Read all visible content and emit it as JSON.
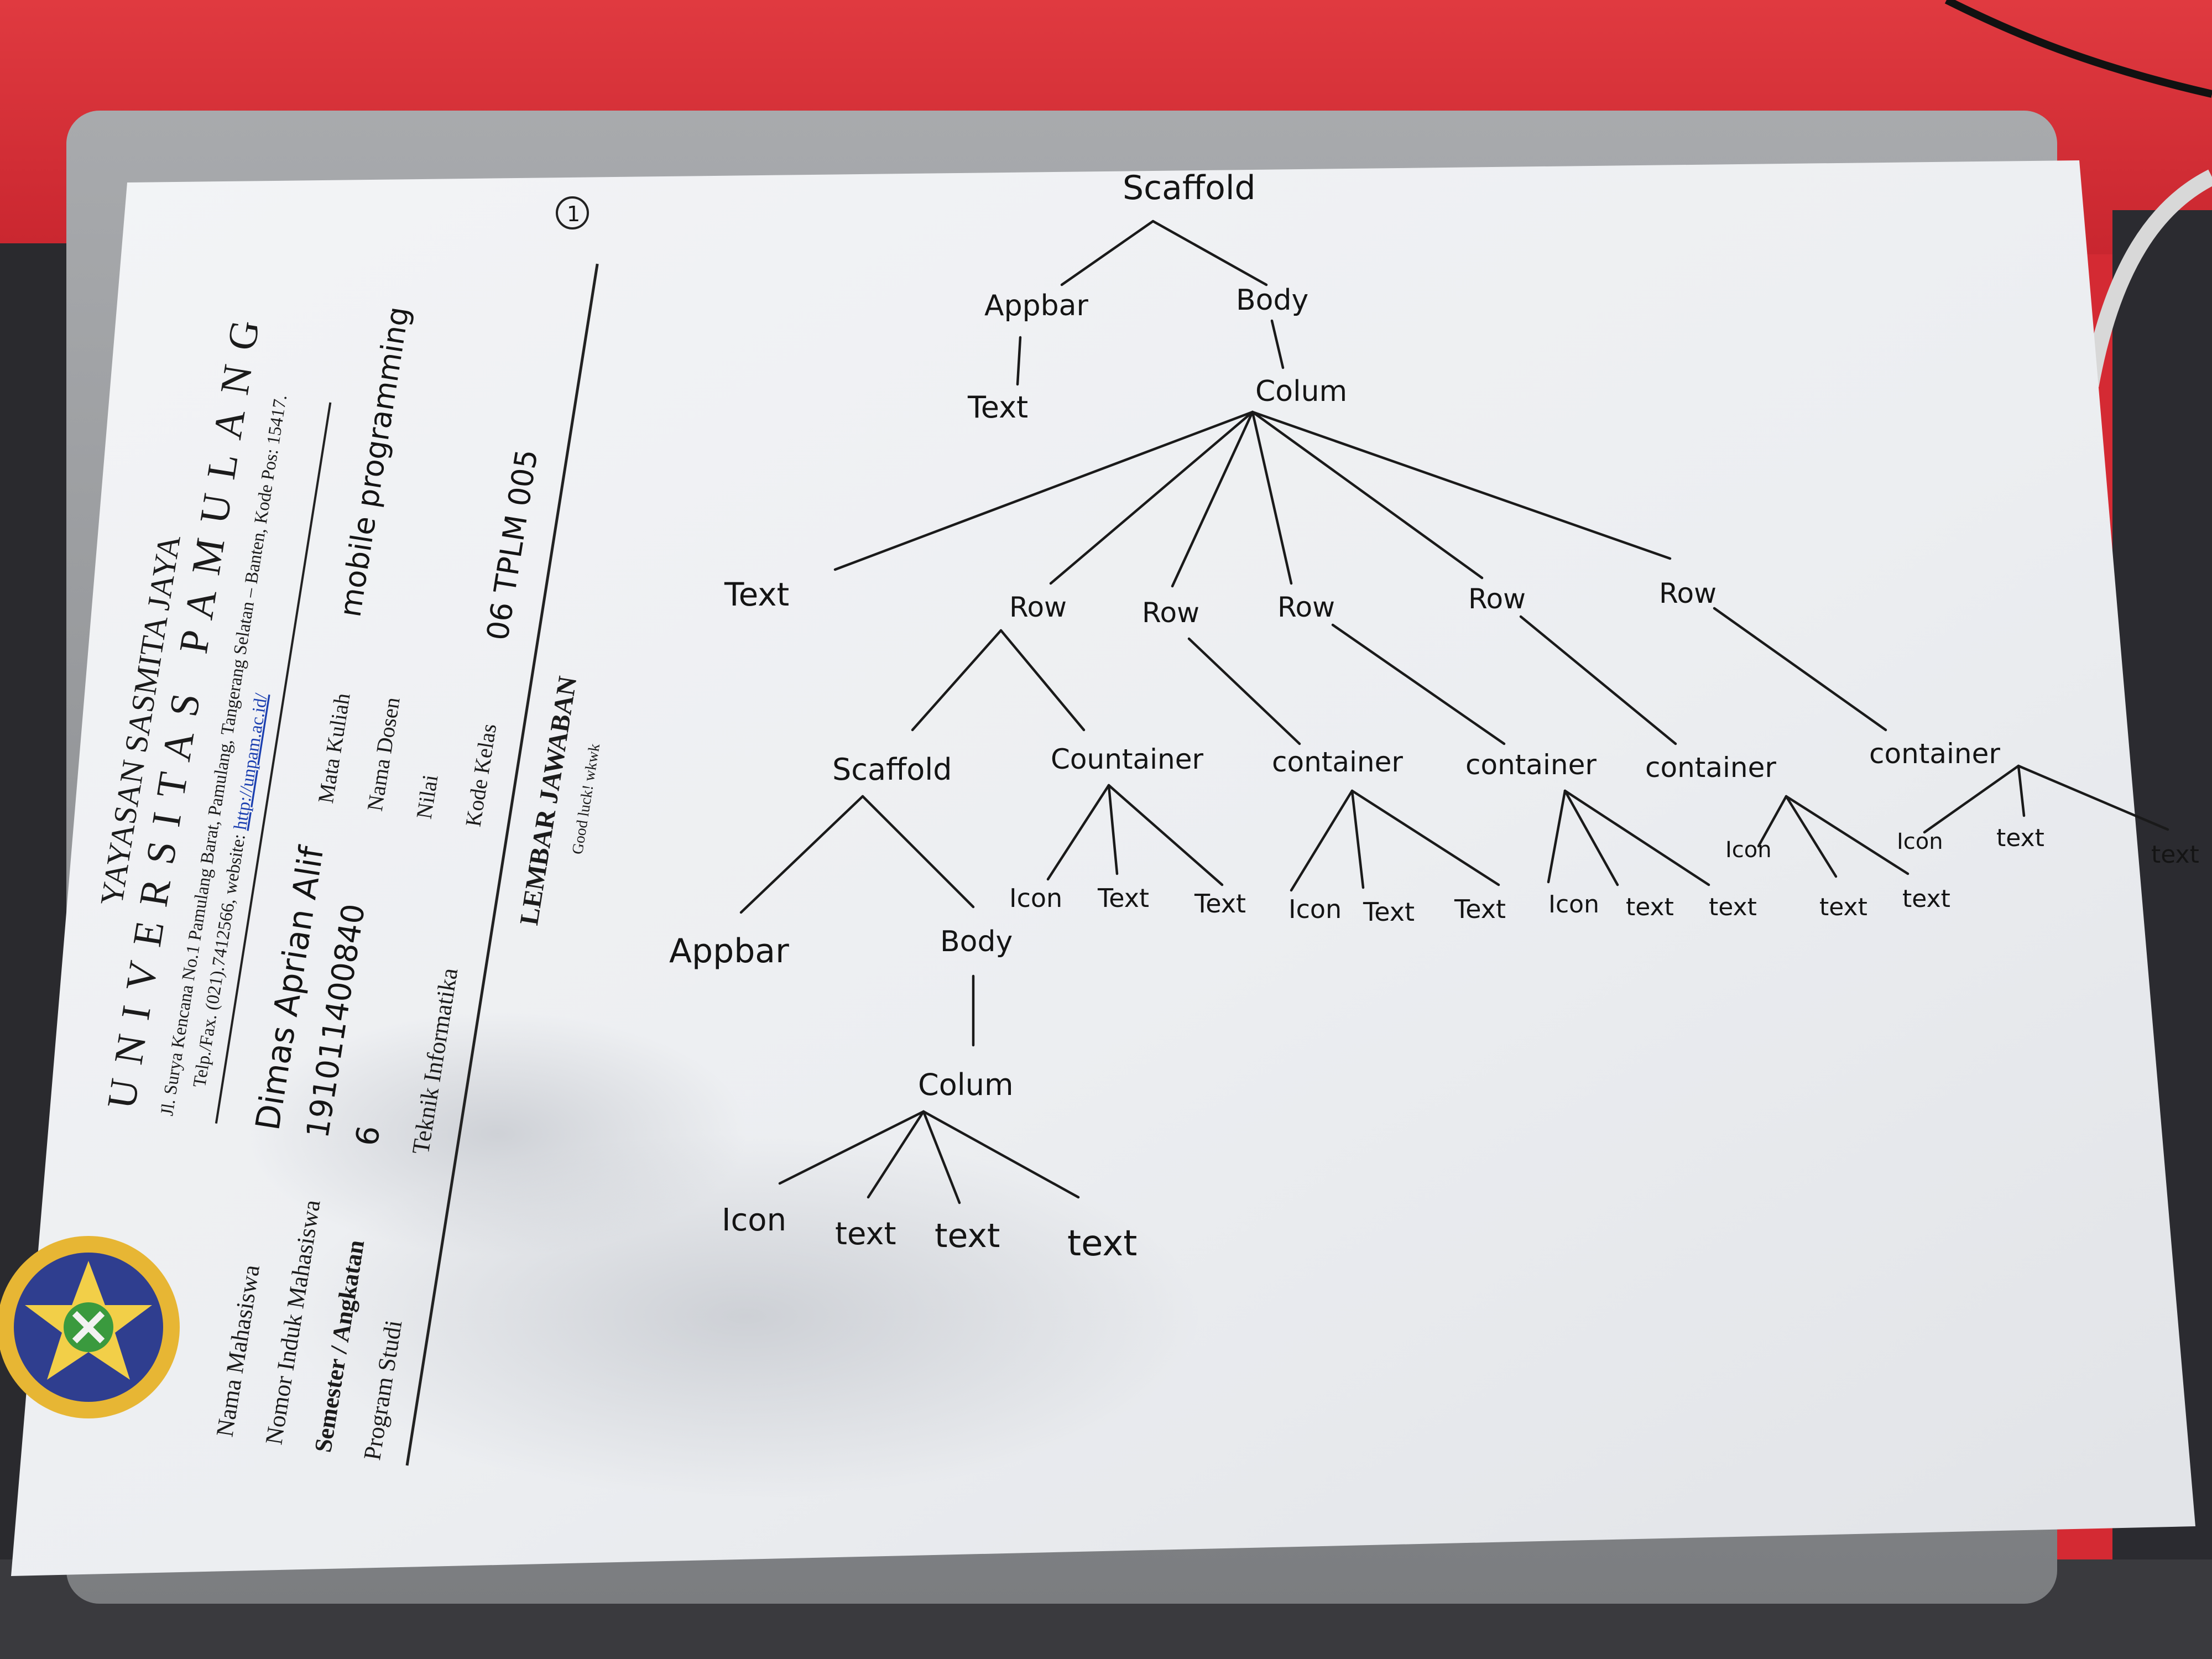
{
  "letterhead": {
    "foundation": "YAYASAN SASMITA JAYA",
    "university": "UNIVERSITAS PAMULANG",
    "address": "Jl. Surya Kencana No.1 Pamulang Barat, Pamulang, Tangerang Selatan – Banten, Kode Pos: 15417.",
    "contact_prefix": "Telp./Fax. (021).7412566, website: ",
    "website": "http://unpam.ac.id/"
  },
  "form": {
    "fields": [
      {
        "label": "Nama Mahasiswa",
        "value": "Dimas Aprian Alif"
      },
      {
        "label": "Nomor Induk Mahasiswa",
        "value": "191011400840"
      },
      {
        "label": "Semester / Angkatan",
        "value": "6"
      },
      {
        "label": "Program Studi",
        "value": "Teknik Informatika"
      },
      {
        "label": "Mata Kuliah",
        "value": "mobile programming"
      },
      {
        "label": "Nama Dosen",
        "value": ""
      },
      {
        "label": "Nilai",
        "value": ""
      },
      {
        "label": "Kode Kelas",
        "value": "06 TPLM 005"
      }
    ],
    "sheet_title": "LEMBAR JAWABAN",
    "sheet_note": "Good luck! wkwk",
    "question_number": "1"
  },
  "tree": {
    "root": "Scaffold",
    "level1": [
      "Appbar",
      "Body"
    ],
    "appbar_child": "Text",
    "body_child": "Colum",
    "colum_children": [
      "Text",
      "Row",
      "Row",
      "Row",
      "Row",
      "Row"
    ],
    "row1_children": [
      "Scaffold",
      "Countainer"
    ],
    "row_containers": [
      "container",
      "container",
      "container",
      "container"
    ],
    "inner_scaffold_children": [
      "Appbar",
      "Body"
    ],
    "inner_body_child": "Colum",
    "inner_colum_children": [
      "Icon",
      "text",
      "text",
      "text"
    ],
    "countainer_children": [
      "Icon",
      "Text",
      "Text"
    ],
    "container2_children": [
      "Icon",
      "Text",
      "Text"
    ],
    "container3_children": [
      "Icon",
      "text",
      "text"
    ],
    "container4_children": [
      "Icon",
      "text",
      "text"
    ],
    "container5_children": [
      "Icon",
      "text",
      "text"
    ]
  },
  "colors": {
    "background_red": "#d42a33",
    "paper": "#f4f5f7",
    "ink": "#141414",
    "logo_gold": "#e7b634",
    "logo_blue": "#2f3e8f",
    "link_blue": "#1b3fb0"
  }
}
